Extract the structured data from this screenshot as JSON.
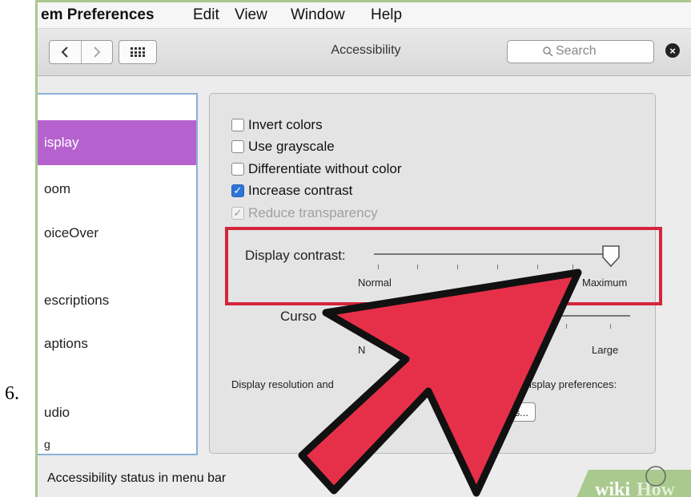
{
  "step_number": "6.",
  "menubar": {
    "app_name": "em Preferences",
    "items": [
      "Edit",
      "View",
      "Window",
      "Help"
    ]
  },
  "toolbar": {
    "back_label": "<",
    "forward_label": ">",
    "title": "Accessibility",
    "search_placeholder": "Search"
  },
  "sidebar": {
    "items": [
      {
        "label": "isplay",
        "selected": true
      },
      {
        "label": "oom"
      },
      {
        "label": "oiceOver"
      },
      {
        "label": "escriptions"
      },
      {
        "label": "aptions"
      },
      {
        "label": "udio"
      },
      {
        "label": "g"
      }
    ]
  },
  "options": [
    {
      "label": "Invert colors",
      "checked": false,
      "enabled": true
    },
    {
      "label": "Use grayscale",
      "checked": false,
      "enabled": true
    },
    {
      "label": "Differentiate without color",
      "checked": false,
      "enabled": true
    },
    {
      "label": "Increase contrast",
      "checked": true,
      "enabled": true
    },
    {
      "label": "Reduce transparency",
      "checked": true,
      "enabled": false
    }
  ],
  "contrast": {
    "label": "Display contrast:",
    "min_label": "Normal",
    "max_label": "Maximum",
    "value_fraction": 1.0
  },
  "cursor": {
    "label": "Curso",
    "min_label": "N",
    "max_label": "Large"
  },
  "display_note": {
    "left": "Display resolution and",
    "right": "d in Display preferences:",
    "button_label": "es..."
  },
  "status": {
    "label": "Accessibility status in menu bar"
  },
  "watermark": {
    "wiki": "wiki",
    "how": "How"
  },
  "colors": {
    "selection": "#b562cf",
    "highlight_box": "#d4253d",
    "arrow": "#e63049",
    "checkbox_on": "#2f74d8"
  },
  "icons": [
    "chevron-left-icon",
    "chevron-right-icon",
    "grid-icon",
    "search-icon",
    "clear-icon",
    "checkmark-icon",
    "slider-thumb-icon",
    "pointer-arrow-icon",
    "wikihow-logo"
  ]
}
